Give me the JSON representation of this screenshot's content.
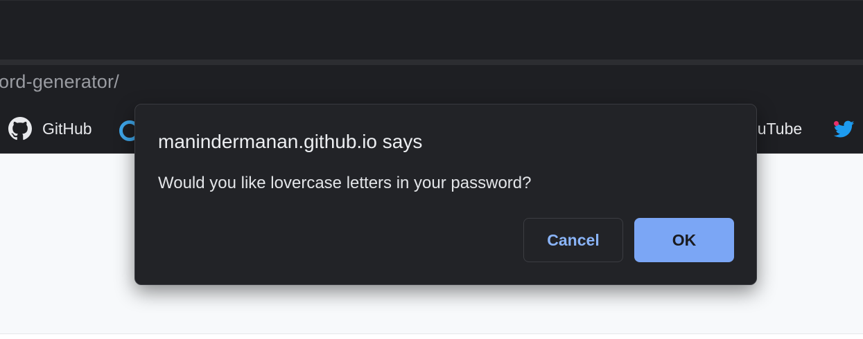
{
  "browser": {
    "url_partial": "ord-generator/",
    "bookmarks": [
      {
        "label": "GitHub",
        "icon": "github-icon"
      },
      {
        "label": "",
        "icon": "ring-icon"
      },
      {
        "label": "ouTube",
        "icon": ""
      },
      {
        "label": "",
        "icon": "twitter-icon"
      }
    ]
  },
  "dialog": {
    "title": "manindermanan.github.io says",
    "message": "Would you like lovercase letters in your password?",
    "cancel_label": "Cancel",
    "ok_label": "OK"
  },
  "colors": {
    "chrome_bg": "#1e1f23",
    "dialog_bg": "#222327",
    "ok_button": "#7ba6f5",
    "cancel_text": "#8ab4f8",
    "twitter_blue": "#1d9bf0"
  }
}
